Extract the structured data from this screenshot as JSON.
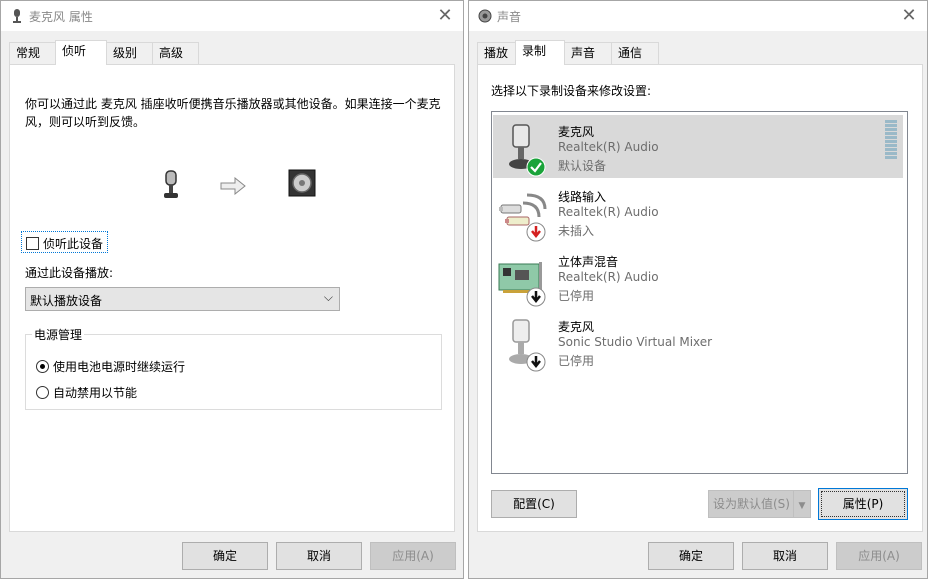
{
  "left_window": {
    "title": "麦克风 属性",
    "tabs": [
      "常规",
      "侦听",
      "级别",
      "高级"
    ],
    "active_tab": "侦听",
    "description": "你可以通过此 麦克风 插座收听便携音乐播放器或其他设备。如果连接一个麦克风，则可以听到反馈。",
    "listen_checkbox_label": "侦听此设备",
    "playback_label": "通过此设备播放:",
    "playback_selected": "默认播放设备",
    "power_group_title": "电源管理",
    "power_options": [
      {
        "label": "使用电池电源时继续运行",
        "selected": true
      },
      {
        "label": "自动禁用以节能",
        "selected": false
      }
    ],
    "buttons": {
      "ok": "确定",
      "cancel": "取消",
      "apply": "应用(A)"
    }
  },
  "right_window": {
    "title": "声音",
    "tabs": [
      "播放",
      "录制",
      "声音",
      "通信"
    ],
    "active_tab": "录制",
    "prompt": "选择以下录制设备来修改设置:",
    "devices": [
      {
        "name": "麦克风",
        "driver": "Realtek(R) Audio",
        "status": "默认设备",
        "badge": "check",
        "selected": true
      },
      {
        "name": "线路输入",
        "driver": "Realtek(R) Audio",
        "status": "未插入",
        "badge": "red-down",
        "selected": false
      },
      {
        "name": "立体声混音",
        "driver": "Realtek(R) Audio",
        "status": "已停用",
        "badge": "black-down",
        "selected": false
      },
      {
        "name": "麦克风",
        "driver": "Sonic Studio Virtual Mixer",
        "status": "已停用",
        "badge": "black-down",
        "selected": false
      }
    ],
    "buttons": {
      "configure": "配置(C)",
      "set_default": "设为默认值(S)",
      "properties": "属性(P)",
      "ok": "确定",
      "cancel": "取消",
      "apply": "应用(A)"
    }
  },
  "colors": {
    "accent": "#0078d7",
    "check_green": "#1aa33a",
    "unplugged_red": "#d42020"
  }
}
